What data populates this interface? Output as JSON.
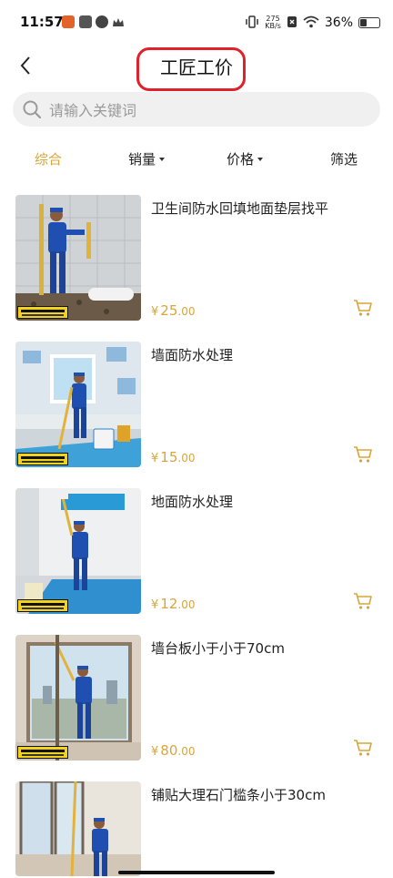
{
  "status_bar": {
    "time": "11:57",
    "net_speed_top": "275",
    "net_speed_bottom": "KB/s",
    "battery": "36%"
  },
  "header": {
    "title": "工匠工价"
  },
  "search": {
    "placeholder": "请输入关键词"
  },
  "filters": [
    {
      "label": "综合",
      "active": true
    },
    {
      "label": "销量",
      "dropdown": true
    },
    {
      "label": "价格",
      "dropdown": true
    },
    {
      "label": "筛选"
    }
  ],
  "products": [
    {
      "title": "卫生间防水回填地面垫层找平",
      "currency": "¥",
      "price_int": "25",
      "price_dec": ".00"
    },
    {
      "title": "墙面防水处理",
      "currency": "¥",
      "price_int": "15",
      "price_dec": ".00"
    },
    {
      "title": "地面防水处理",
      "currency": "¥",
      "price_int": "12",
      "price_dec": ".00"
    },
    {
      "title": "墙台板小于小于70cm",
      "currency": "¥",
      "price_int": "80",
      "price_dec": ".00"
    },
    {
      "title": "铺贴大理石门槛条小于30cm",
      "currency": "¥",
      "price_int": "",
      "price_dec": ""
    }
  ],
  "colors": {
    "accent": "#d9a53a",
    "highlight_circle": "#e0202a",
    "worker_blue": "#1f4fb0"
  }
}
